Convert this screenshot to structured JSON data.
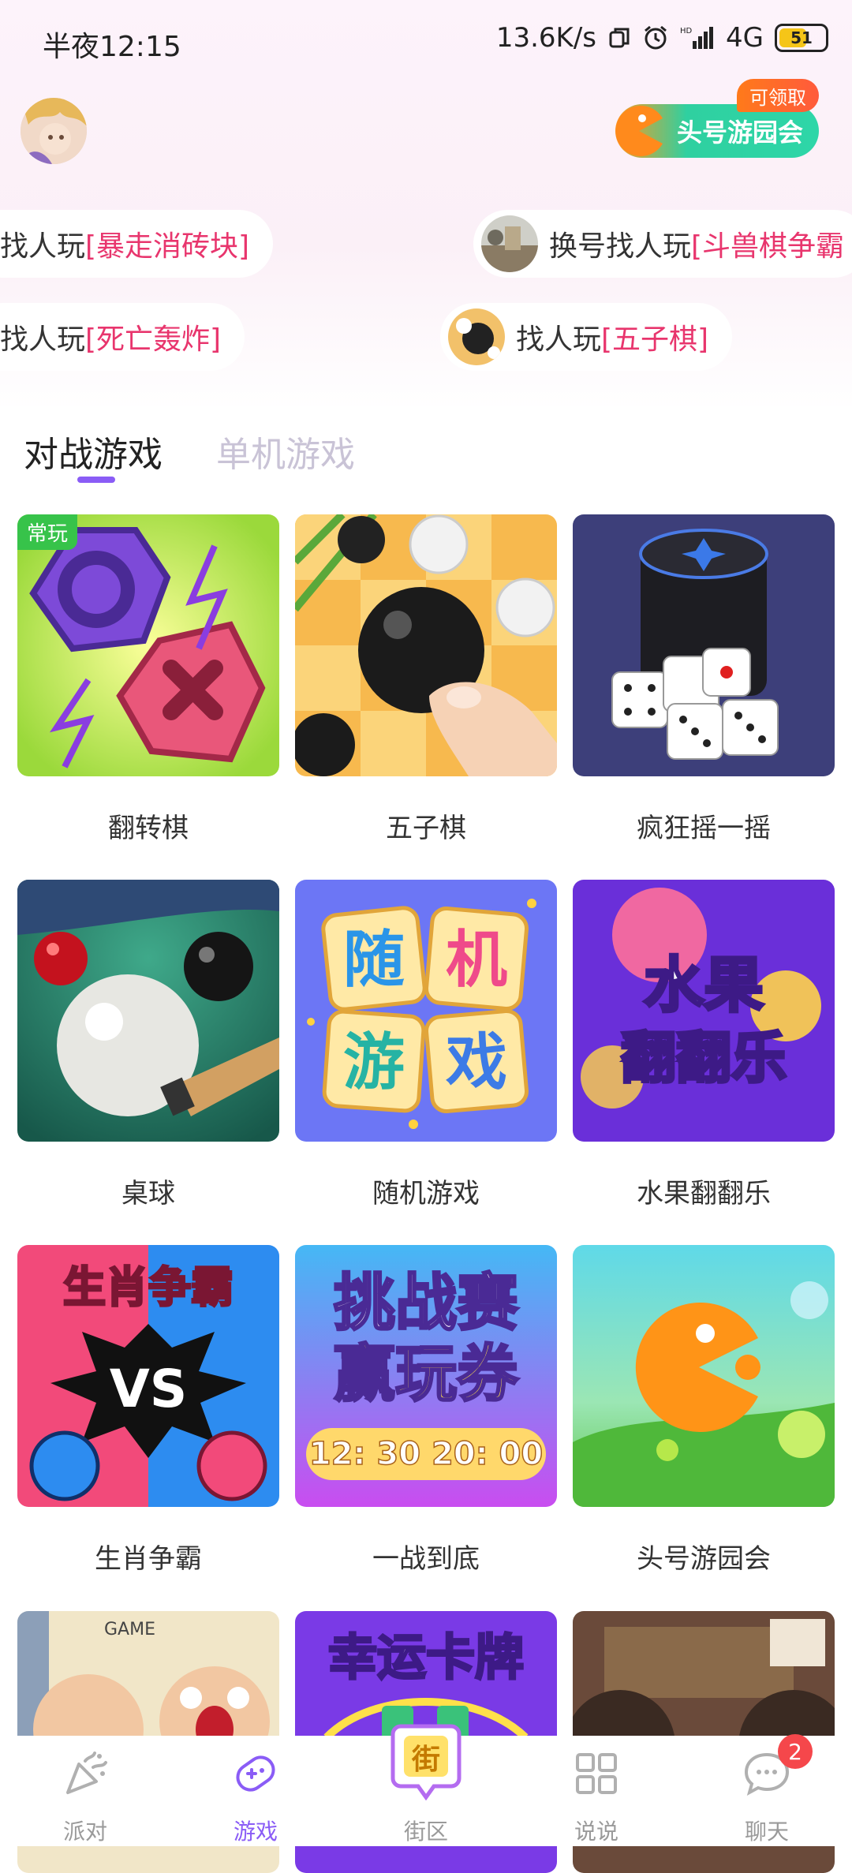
{
  "status_bar": {
    "time": "半夜12:15",
    "net_speed": "13.6K/s",
    "network": "4G",
    "battery": "51"
  },
  "header": {
    "event_badge": "头号游园会",
    "claim_tag": "可领取"
  },
  "marquee": [
    {
      "prefix": "找人玩",
      "game": "[暴走消砖块]"
    },
    {
      "prefix": "换号找人玩",
      "game": "[斗兽棋争霸"
    },
    {
      "prefix": "找人玩",
      "game": "[死亡轰炸]"
    },
    {
      "prefix": "找人玩",
      "game": "[五子棋]"
    }
  ],
  "tabs": {
    "active": "对战游戏",
    "inactive": "单机游戏"
  },
  "games": [
    {
      "name": "翻转棋",
      "tag": "常玩"
    },
    {
      "name": "五子棋"
    },
    {
      "name": "疯狂摇一摇"
    },
    {
      "name": "桌球"
    },
    {
      "name": "随机游戏",
      "art_text": [
        "随",
        "机",
        "游",
        "戏"
      ]
    },
    {
      "name": "水果翻翻乐",
      "art_text": [
        "水果",
        "翻翻乐"
      ]
    },
    {
      "name": "生肖争霸",
      "art_text": [
        "生肖争霸",
        "VS"
      ]
    },
    {
      "name": "一战到底",
      "art_text": [
        "挑战赛",
        "赢玩券",
        "12: 30 20: 00"
      ]
    },
    {
      "name": "头号游园会"
    },
    {
      "name": "",
      "art_text": [
        "GAME"
      ]
    },
    {
      "name": "",
      "art_text": [
        "幸运卡牌"
      ]
    },
    {
      "name": ""
    }
  ],
  "bottom_nav": [
    {
      "label": "派对"
    },
    {
      "label": "游戏"
    },
    {
      "label": "街区",
      "icon_text": "街"
    },
    {
      "label": "说说"
    },
    {
      "label": "聊天",
      "badge": "2"
    }
  ],
  "colors": {
    "accent": "#8a5cf6",
    "highlight_game": "#e8356d",
    "tag_green": "#37c34a",
    "badge_red": "#f5474b"
  }
}
